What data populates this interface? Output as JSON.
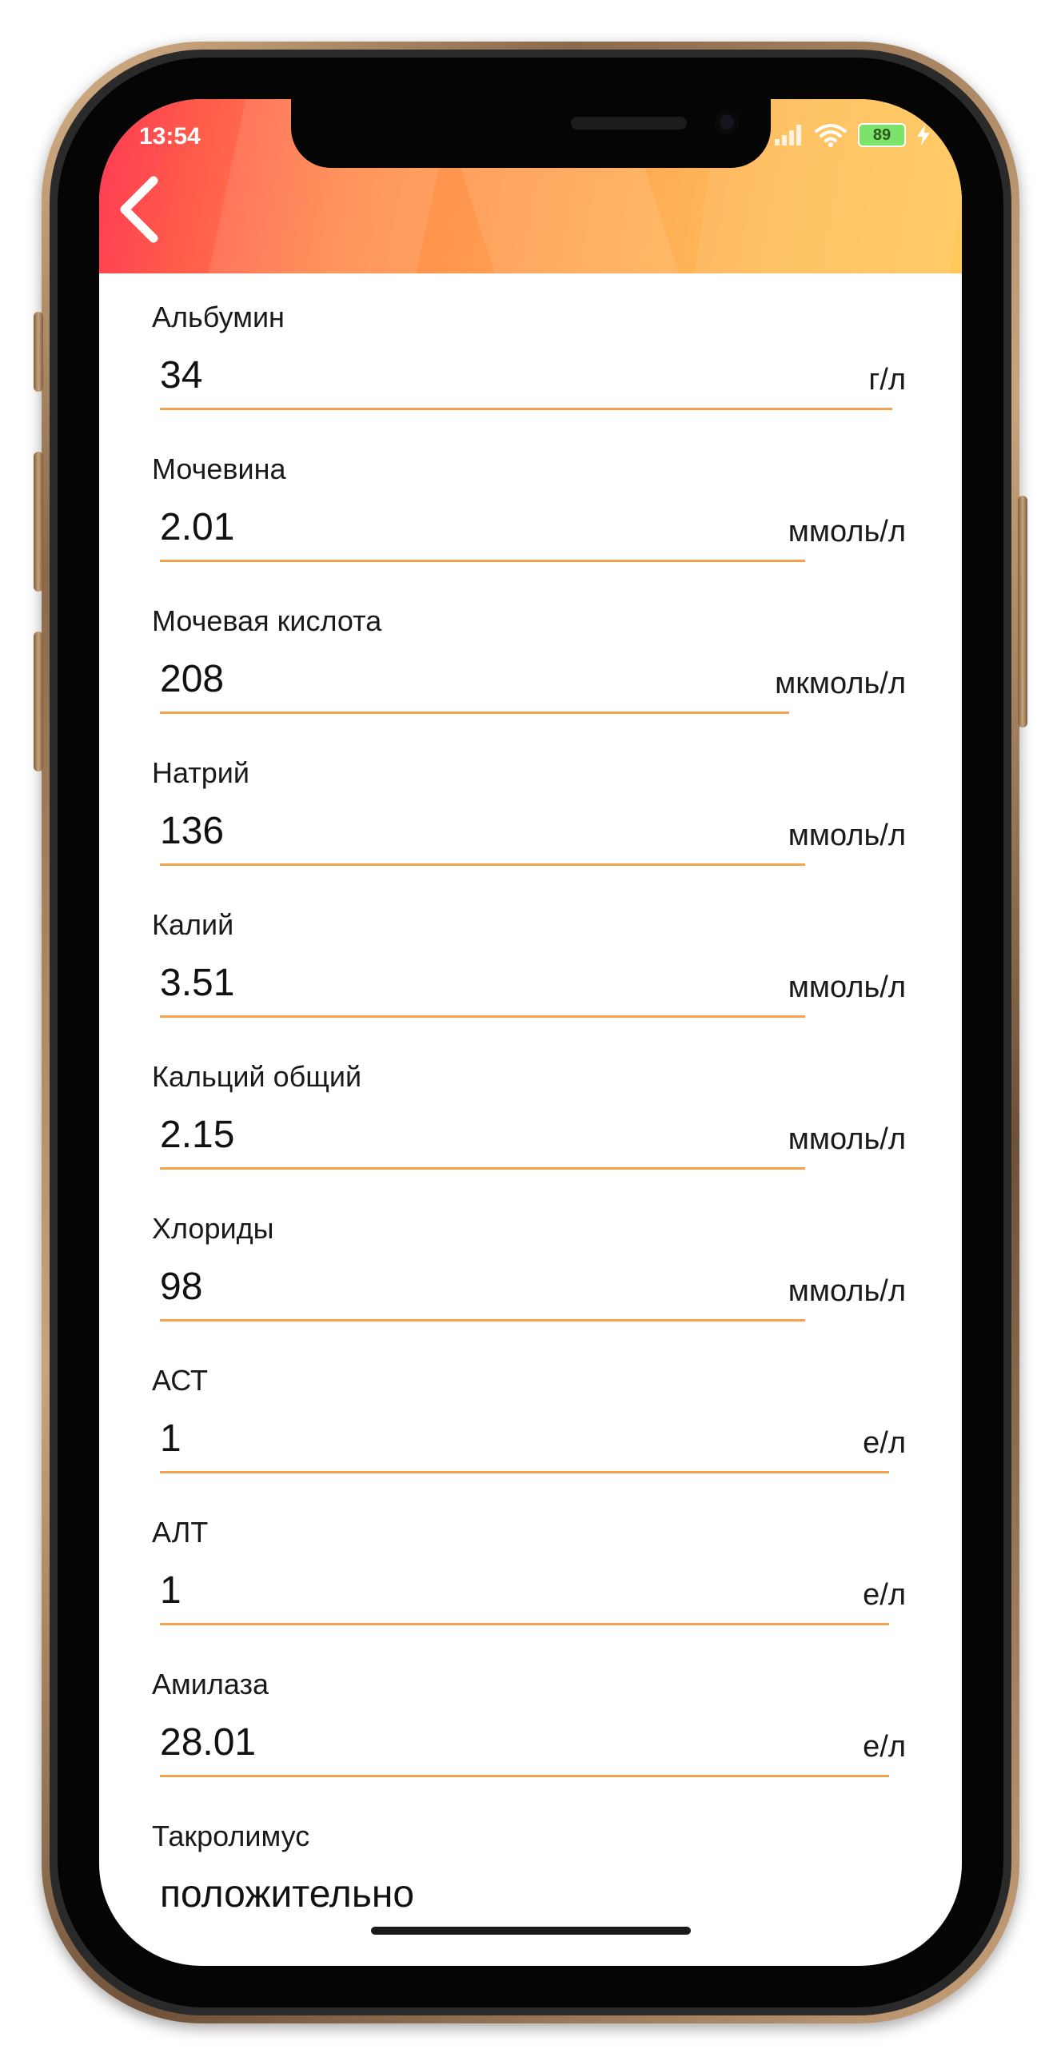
{
  "status_bar": {
    "time": "13:54",
    "battery": "89"
  },
  "colors": {
    "accent_line": "#f4a24f",
    "header_start": "#ff3a55",
    "header_end": "#ffc85a"
  },
  "fields": [
    {
      "label": "Альбумин",
      "value": "34",
      "unit": "г/л"
    },
    {
      "label": "Мочевина",
      "value": "2.01",
      "unit": "ммоль/л"
    },
    {
      "label": "Мочевая кислота",
      "value": "208",
      "unit": "мкмоль/л"
    },
    {
      "label": "Натрий",
      "value": "136",
      "unit": "ммоль/л"
    },
    {
      "label": "Калий",
      "value": "3.51",
      "unit": "ммоль/л"
    },
    {
      "label": "Кальций общий",
      "value": "2.15",
      "unit": "ммоль/л"
    },
    {
      "label": "Хлориды",
      "value": "98",
      "unit": "ммоль/л"
    },
    {
      "label": "АСТ",
      "value": "1",
      "unit": "е/л"
    },
    {
      "label": "АЛТ",
      "value": "1",
      "unit": "е/л"
    },
    {
      "label": "Амилаза",
      "value": "28.01",
      "unit": "е/л"
    },
    {
      "label": "Такролимус",
      "value": "положительно",
      "unit": ""
    }
  ]
}
